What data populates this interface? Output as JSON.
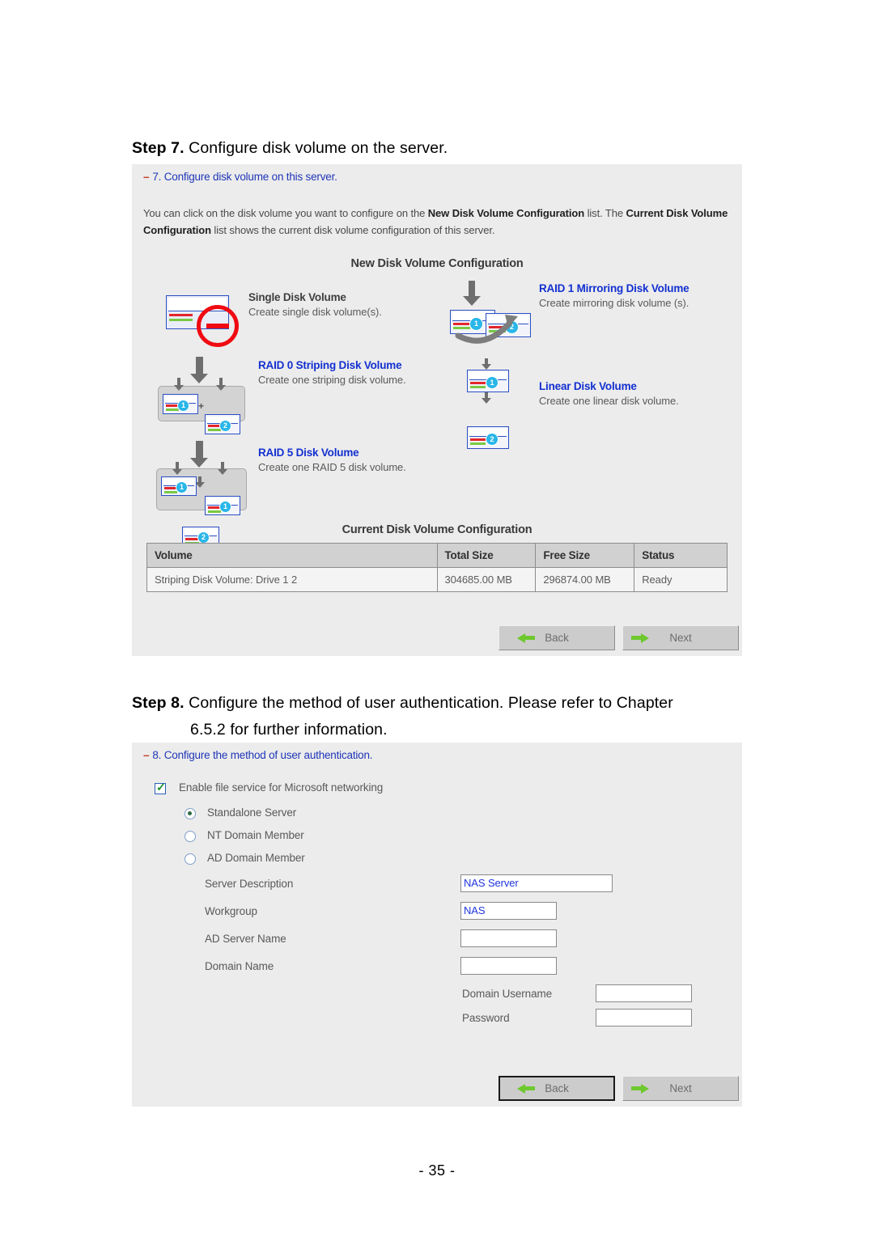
{
  "document": {
    "page_number": "- 35 -"
  },
  "step7": {
    "label": "Step 7.",
    "text": "Configure disk volume on the server.",
    "panel": {
      "title_dash": "–",
      "title": "7. Configure disk volume on this server.",
      "description_1": "You can click on the disk volume you want to configure on the ",
      "description_b1": "New Disk Volume Configuration",
      "description_2": " list. The ",
      "description_b2": "Current Disk Volume Configuration",
      "description_3": " list shows the current disk volume configuration of this server.",
      "new_volume_title": "New Disk Volume Configuration",
      "current_volume_title": "Current Disk Volume Configuration",
      "options": [
        {
          "icon": "single-disk-disabled-icon",
          "name": "Single Disk Volume",
          "desc": "Create single disk volume(s).",
          "enabled": false
        },
        {
          "icon": "raid1-mirroring-icon",
          "name": "RAID 1 Mirroring Disk Volume",
          "desc": "Create mirroring disk volume (s).",
          "enabled": true
        },
        {
          "icon": "raid0-striping-icon",
          "name": "RAID 0 Striping Disk Volume",
          "desc": "Create one striping disk volume.",
          "enabled": true
        },
        {
          "icon": "linear-disk-icon",
          "name": "Linear Disk Volume",
          "desc": "Create one linear disk volume.",
          "enabled": true
        },
        {
          "icon": "raid5-disk-icon",
          "name": "RAID 5 Disk Volume",
          "desc": "Create one RAID 5 disk volume.",
          "enabled": true
        }
      ],
      "table": {
        "headers": [
          "Volume",
          "Total Size",
          "Free Size",
          "Status"
        ],
        "rows": [
          [
            "Striping Disk Volume: Drive 1 2",
            "304685.00 MB",
            "296874.00 MB",
            "Ready"
          ]
        ]
      },
      "back_label": "Back",
      "next_label": "Next"
    }
  },
  "step8": {
    "label": "Step 8.",
    "text_line1": "Configure the method of user authentication.  Please refer to Chapter",
    "text_line2": "6.5.2 for further information.",
    "panel": {
      "title_dash": "–",
      "title": "8. Configure the method of user authentication.",
      "enable_checkbox_label": "Enable file service for Microsoft networking",
      "enable_checkbox_checked": true,
      "radios": [
        {
          "label": "Standalone Server",
          "checked": true
        },
        {
          "label": "NT Domain Member",
          "checked": false
        },
        {
          "label": "AD Domain Member",
          "checked": false
        }
      ],
      "fields": [
        {
          "label": "Server Description",
          "value": "NAS Server",
          "placeholder": ""
        },
        {
          "label": "Workgroup",
          "value": "NAS",
          "placeholder": ""
        },
        {
          "label": "AD Server Name",
          "value": "",
          "placeholder": ""
        },
        {
          "label": "Domain Name",
          "value": "",
          "placeholder": ""
        }
      ],
      "credentials": [
        {
          "label": "Domain Username",
          "value": "",
          "placeholder": ""
        },
        {
          "label": "Password",
          "value": "",
          "placeholder": ""
        }
      ],
      "back_label": "Back",
      "next_label": "Next"
    }
  },
  "colors": {
    "panel_background": "#ececec",
    "link_blue": "#1330d0",
    "title_blue": "#2036b8",
    "dash_red": "#c23b22",
    "arrow_green": "#6ec82e",
    "disk_blue": "#2b4fc4",
    "badge_cyan": "#29b6e8",
    "no_sign_red": "#f00a12"
  }
}
